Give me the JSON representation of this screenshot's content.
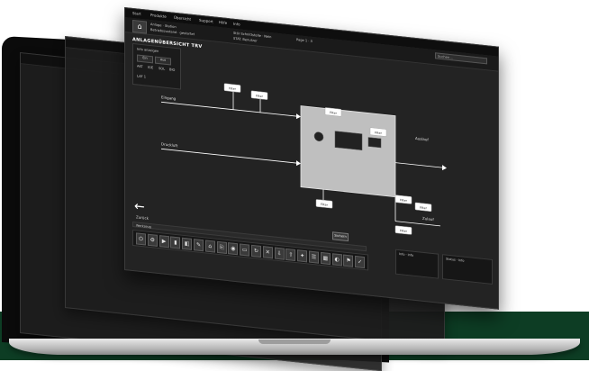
{
  "colors": {
    "band": "#0d3d24",
    "window": "#232323",
    "flow_box": "#bfbfbf",
    "arrows": "#ffffff"
  },
  "menu": [
    "Start",
    "Produkte",
    "Übersicht",
    "Support",
    "Hilfe",
    "Info"
  ],
  "header": {
    "line1": "Anlage · Station",
    "line2": "Betriebszustand · gestartet",
    "line3": "Stör·Schnittstelle · Nein",
    "line4": "STAT. Benutzer",
    "page": "Page 1 · 3",
    "search_placeholder": "Suchen ..."
  },
  "title": "ANLAGENÜBERSICHT TRV",
  "left_panel": {
    "heading": "Info anzeigen",
    "btn_on": "Ein",
    "btn_off": "Aus",
    "row": [
      "AKT",
      "IGE",
      "SOL",
      "BIO"
    ],
    "footer": "LAF 1"
  },
  "diagram": {
    "labels": {
      "eingang": "Eingang",
      "druckluft": "Druckluft",
      "auslauf": "Auslauf",
      "zulauf": "Zulauf"
    },
    "boxes": [
      "Filter",
      "Filter",
      "Filter",
      "Filter",
      "Filter",
      "Filter",
      "Filter",
      "Filter"
    ]
  },
  "back": {
    "arrow": "←",
    "label": "Zurück"
  },
  "toolbar": {
    "header": "Werkzeug",
    "save": "Sichern",
    "panel_a": "Info · Info",
    "panel_b": "Status · Info"
  },
  "tools": [
    "⏻",
    "⚙",
    "▶",
    "▮",
    "◧",
    "✎",
    "⌂",
    "⎘",
    "◉",
    "▭",
    "↻",
    "✕",
    "⇩",
    "⇧",
    "✦",
    "☰",
    "▦",
    "◐",
    "⚑",
    "✓"
  ]
}
